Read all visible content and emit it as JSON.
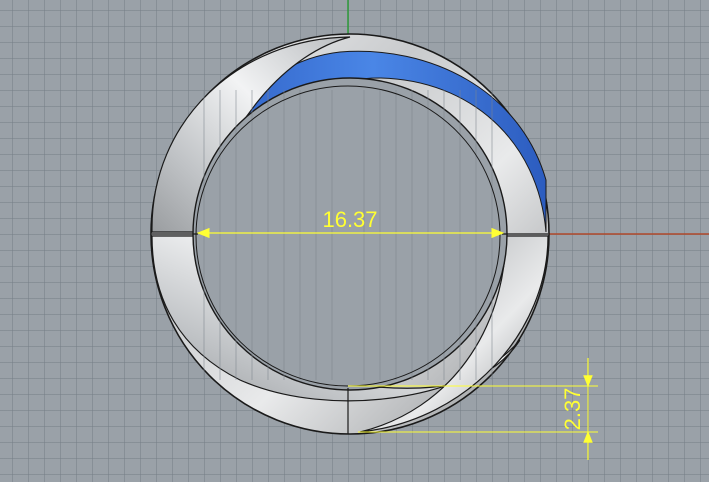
{
  "viewport": {
    "background_color": "#9aa1a8",
    "grid_color": "#7d858d",
    "axis_x_color": "#b0482a",
    "axis_y_color": "#2e9a3a"
  },
  "model": {
    "metal_color": "#d6d8da",
    "edge_color": "#1a1a1a",
    "inner_band_color": "#3f78d8"
  },
  "dimensions": {
    "inner_diameter": "16.37",
    "band_width": "2.37",
    "color": "#ffff33"
  }
}
